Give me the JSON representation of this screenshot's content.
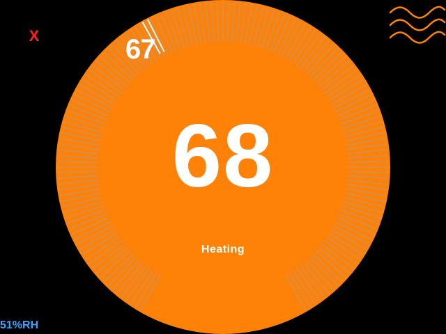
{
  "thermostat": {
    "close_label": "X",
    "ambient_temperature": "67",
    "target_temperature": "68",
    "mode": "Heating",
    "humidity": "51%RH"
  },
  "colors": {
    "dial_fill": "#ff8208",
    "tick_color": "#8aa6c8",
    "ambient_marker": "#ffffff",
    "close_color": "#ff1f1f",
    "humidity_color": "#3aa3ff",
    "heat_icon_color": "#ff8208",
    "background": "#000000"
  },
  "icons": {
    "close": "close-icon",
    "heat": "heat-wave-icon"
  }
}
